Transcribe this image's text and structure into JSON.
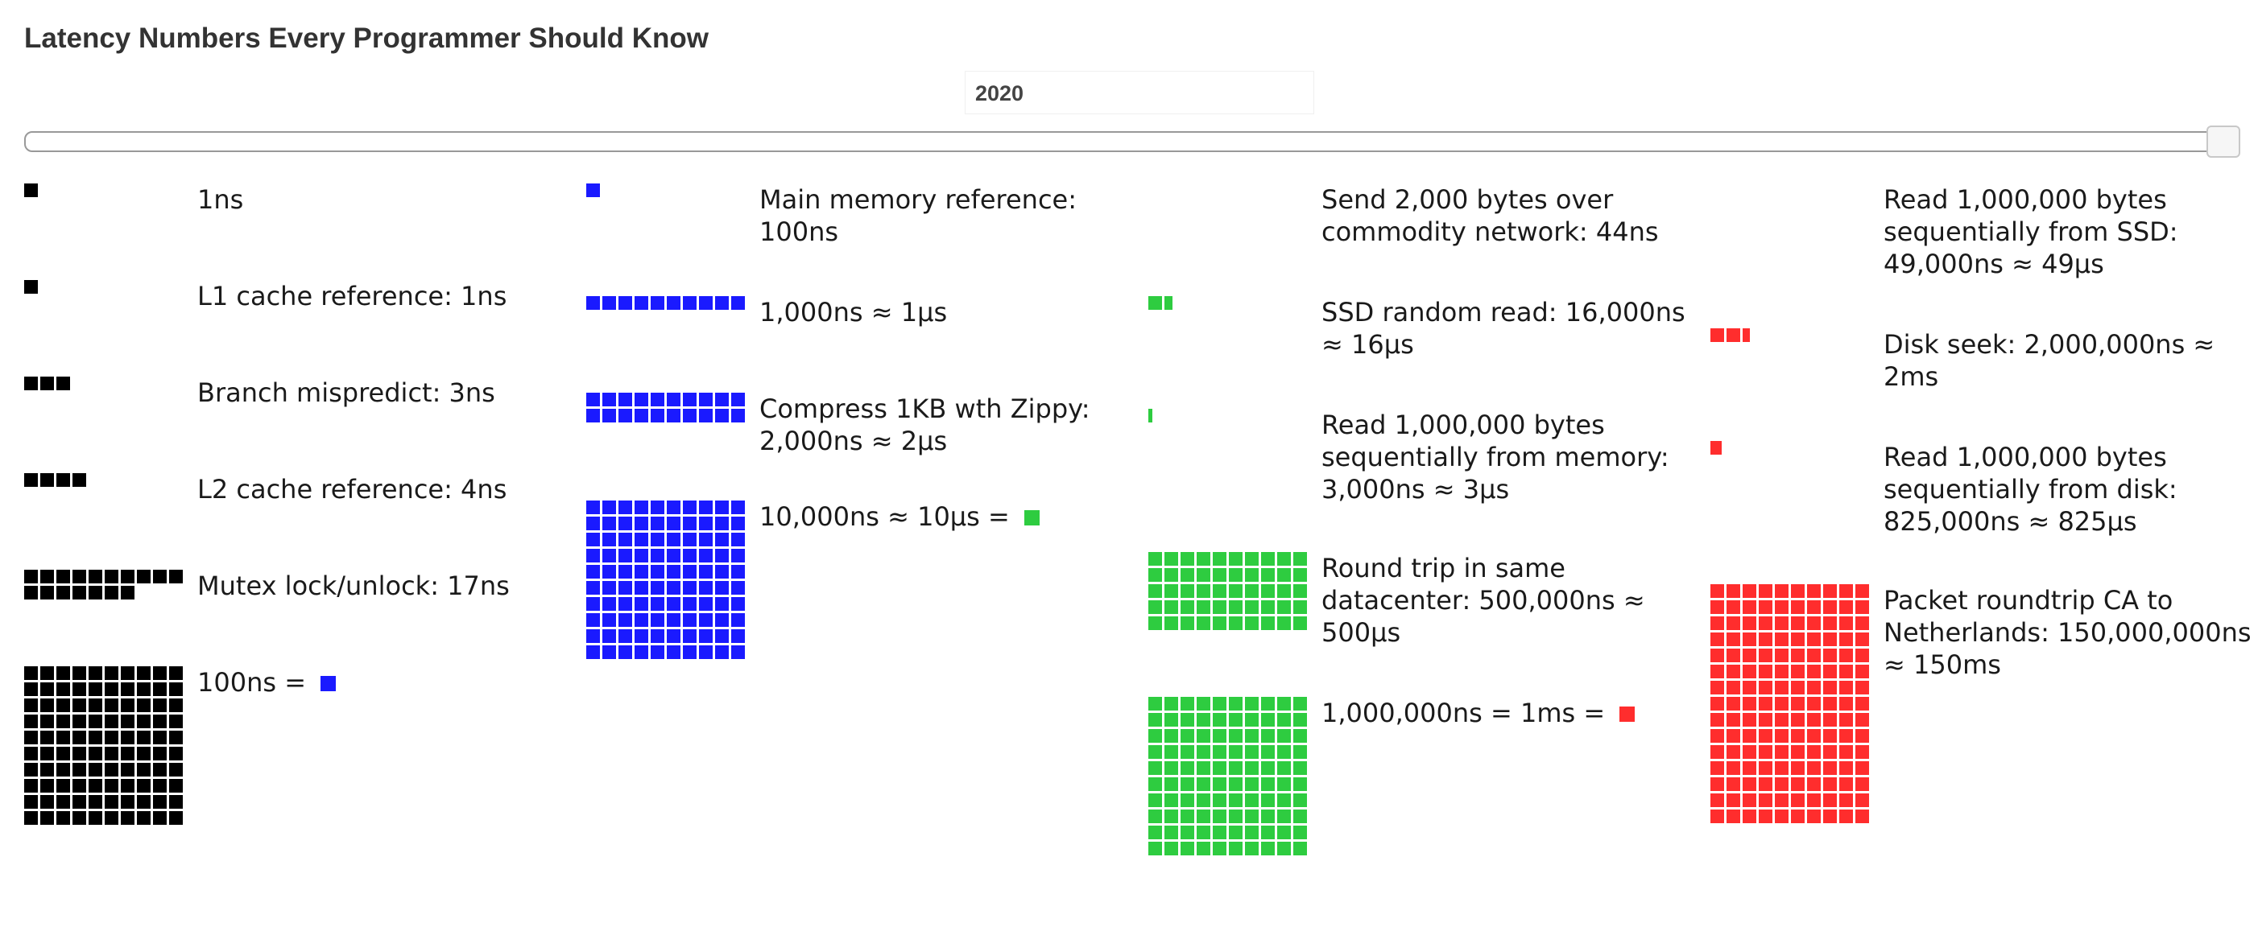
{
  "title": "Latency Numbers Every Programmer Should Know",
  "year": "2020",
  "slider": {
    "year": 2020
  },
  "legend_colors": {
    "ns": "#000000",
    "100ns": "#1a1aff",
    "10us": "#2ecc40",
    "1ms": "#ff2d2d"
  },
  "columns": [
    {
      "entries": [
        {
          "label": "1ns",
          "color": "#000000",
          "size": "l",
          "cells": 1
        },
        {
          "label": "L1 cache reference: 1ns",
          "color": "#000000",
          "size": "l",
          "cells": 1
        },
        {
          "label": "Branch mispredict: 3ns",
          "color": "#000000",
          "size": "l",
          "cells": 3
        },
        {
          "label": "L2 cache reference: 4ns",
          "color": "#000000",
          "size": "l",
          "cells": 4
        },
        {
          "label": "Mutex lock/unlock: 17ns",
          "color": "#000000",
          "size": "l",
          "cells": 17
        },
        {
          "label": "100ns = ",
          "color": "#000000",
          "size": "l",
          "cells": 100,
          "equals_color": "#1a1aff"
        }
      ]
    },
    {
      "entries": [
        {
          "label": "Main memory reference: 100ns",
          "color": "#1a1aff",
          "size": "s",
          "cells": 1
        },
        {
          "label": "1,000ns ≈ 1µs",
          "color": "#1a1aff",
          "size": "l",
          "cells": 10
        },
        {
          "label": "Compress 1KB wth Zippy: 2,000ns ≈ 2µs",
          "color": "#1a1aff",
          "size": "l",
          "cells": 20
        },
        {
          "label": "10,000ns ≈ 10µs = ",
          "color": "#1a1aff",
          "size": "l",
          "cells": 100,
          "equals_color": "#2ecc40"
        }
      ]
    },
    {
      "entries": [
        {
          "label": "Send 2,000 bytes over commodity network: 44ns",
          "color": "#2ecc40",
          "size": "l",
          "cells": 0
        },
        {
          "label": "SSD random read: 16,000ns ≈ 16µs",
          "color": "#2ecc40",
          "size": "l",
          "cells": 1.6
        },
        {
          "label": "Read 1,000,000 bytes sequentially from memory: 3,000ns ≈ 3µs",
          "color": "#2ecc40",
          "size": "l",
          "cells": 0.3
        },
        {
          "label": "Round trip in same datacenter: 500,000ns ≈ 500µs",
          "color": "#2ecc40",
          "size": "l",
          "cells": 50
        },
        {
          "label": "1,000,000ns = 1ms = ",
          "color": "#2ecc40",
          "size": "l",
          "cells": 100,
          "equals_color": "#ff2d2d"
        }
      ]
    },
    {
      "entries": [
        {
          "label": "Read 1,000,000 bytes sequentially from SSD: 49,000ns ≈ 49µs",
          "color": "#ff2d2d",
          "size": "l",
          "cells": 0
        },
        {
          "label": "Disk seek: 2,000,000ns ≈ 2ms",
          "color": "#ff2d2d",
          "size": "l",
          "cells": 2.5
        },
        {
          "label": "Read 1,000,000 bytes sequentially from disk: 825,000ns ≈ 825µs",
          "color": "#ff2d2d",
          "size": "l",
          "cells": 0.8
        },
        {
          "label": "Packet roundtrip CA to Netherlands: 150,000,000ns ≈ 150ms",
          "color": "#ff2d2d",
          "size": "l",
          "cells": 150
        }
      ]
    }
  ]
}
